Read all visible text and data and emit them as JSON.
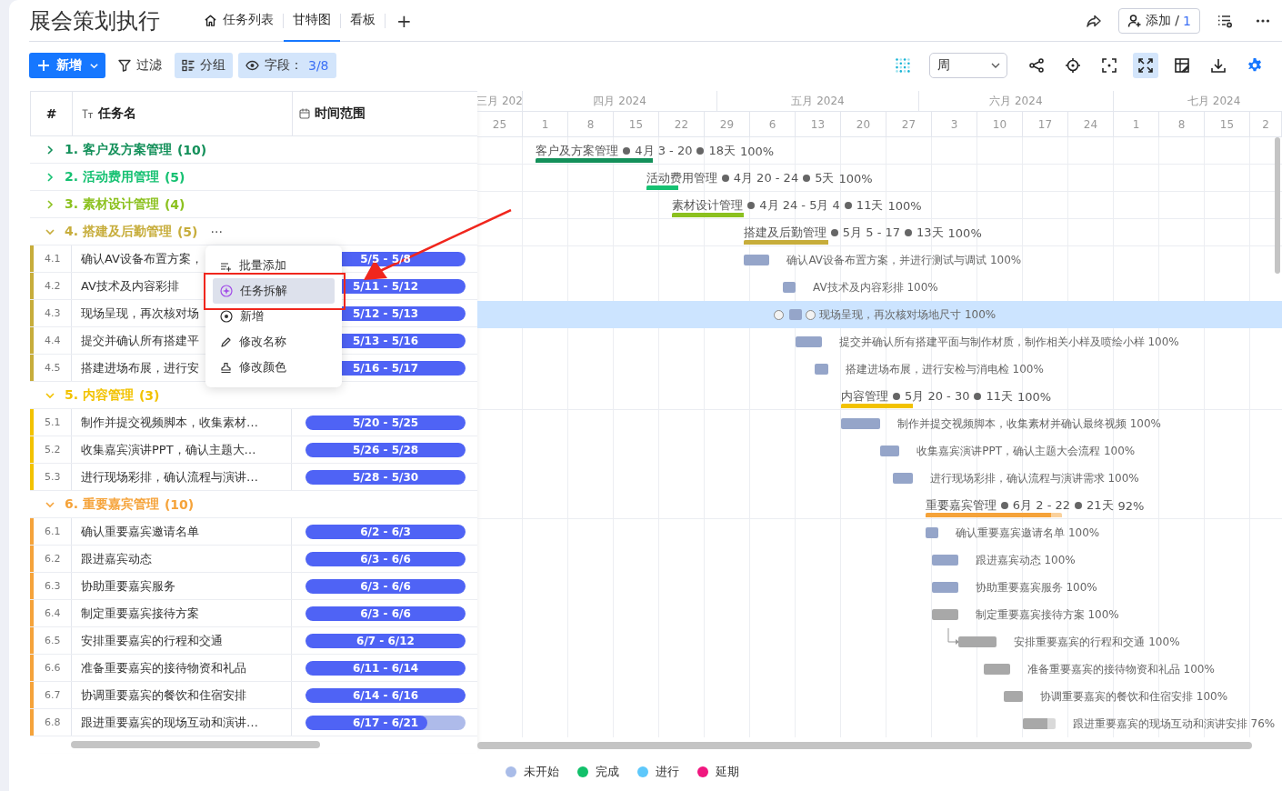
{
  "title": "展会策划执行",
  "tabs": [
    {
      "label": "任务列表",
      "kind": "home",
      "selected": false
    },
    {
      "label": "甘特图",
      "kind": "plain",
      "selected": true
    },
    {
      "label": "看板",
      "kind": "plain",
      "selected": false
    }
  ],
  "add_tab": "+",
  "add_member": {
    "label": "添加 /",
    "count": "1"
  },
  "toolbar": {
    "new": "新增",
    "filter": {
      "label": "过滤",
      "active": false
    },
    "group": {
      "label": "分组",
      "active": true
    },
    "fields": {
      "label": "字段：",
      "count": "3/8",
      "active": true
    },
    "scale": "周",
    "tools": [
      {
        "kind": "nodes",
        "active": false
      },
      {
        "kind": "locate",
        "active": false
      },
      {
        "kind": "focus",
        "active": false
      },
      {
        "kind": "expand",
        "active": true
      },
      {
        "kind": "freeze",
        "active": false
      },
      {
        "kind": "download",
        "active": false
      },
      {
        "kind": "settings",
        "active": false
      }
    ]
  },
  "columns": [
    "#",
    "任务名",
    "时间范围"
  ],
  "months": [
    "三月 202",
    "四月 2024",
    "五月 2024",
    "六月 2024",
    "七月 2024"
  ],
  "weeks": [
    "25",
    "1",
    "8",
    "15",
    "22",
    "29",
    "6",
    "13",
    "20",
    "27",
    "3",
    "10",
    "17",
    "24",
    "1",
    "8",
    "15",
    "2"
  ],
  "groups": [
    {
      "title": "1. 客户及方案管理",
      "count": "(10)",
      "color": "#14905a",
      "expanded": false,
      "gantt": {
        "name": "客户及方案管理",
        "range": "4月 3 - 20",
        "duration": "18天",
        "progress": "100%",
        "level": 1
      }
    },
    {
      "title": "2. 活动费用管理",
      "count": "(5)",
      "color": "#16c172",
      "expanded": false,
      "gantt": {
        "name": "活动费用管理",
        "range": "4月 20 - 24",
        "duration": "5天",
        "progress": "100%",
        "level": 1
      }
    },
    {
      "title": "3. 素材设计管理",
      "count": "(4)",
      "color": "#8cc11f",
      "expanded": false,
      "gantt": {
        "name": "素材设计管理",
        "range": "4月 24 - 5月 4",
        "duration": "11天",
        "progress": "100%",
        "level": 1
      }
    },
    {
      "title": "4. 搭建及后勤管理",
      "count": "(5)",
      "color": "#c7ad3b",
      "expanded": true,
      "more": "···",
      "gantt": {
        "name": "搭建及后勤管理",
        "range": "5月 5 - 17",
        "duration": "13天",
        "progress": "100%",
        "level": 1
      },
      "tasks": [
        {
          "index": "4.1",
          "name": "确认AV设备布置方案，",
          "range": "5/5 - 5/8",
          "level": 1,
          "color": "#95a5c9",
          "selected": false,
          "linked": false,
          "gantt_label": "确认AV设备布置方案，并进行测试与调试 100%"
        },
        {
          "index": "4.2",
          "name": "AV技术及内容彩排",
          "range": "5/11 - 5/12",
          "level": 1,
          "color": "#95a5c9",
          "selected": false,
          "linked": false,
          "gantt_label": "AV技术及内容彩排 100%"
        },
        {
          "index": "4.3",
          "name": "现场呈现，再次核对场",
          "range": "5/12 - 5/13",
          "level": 1,
          "color": "#95a5c9",
          "selected": true,
          "linked": false,
          "gantt_label": "现场呈现，再次核对场地尺寸 100%"
        },
        {
          "index": "4.4",
          "name": "提交并确认所有搭建平",
          "range": "5/13 - 5/16",
          "level": 1,
          "color": "#95a5c9",
          "selected": false,
          "linked": false,
          "gantt_label": "提交并确认所有搭建平面与制作材质，制作相关小样及喷绘小样 100%"
        },
        {
          "index": "4.5",
          "name": "搭建进场布展，进行安",
          "range": "5/16 - 5/17",
          "level": 1,
          "color": "#95a5c9",
          "selected": false,
          "linked": false,
          "gantt_label": "搭建进场布展，进行安检与消电检 100%"
        }
      ]
    },
    {
      "title": "5. 内容管理",
      "count": "(3)",
      "color": "#f2c200",
      "expanded": true,
      "gantt": {
        "name": "内容管理",
        "range": "5月 20 - 30",
        "duration": "11天",
        "progress": "100%",
        "level": 1
      },
      "tasks": [
        {
          "index": "5.1",
          "name": "制作并提交视频脚本，收集素材…",
          "range": "5/20 - 5/25",
          "level": 1,
          "color": "#95a5c9",
          "selected": false,
          "linked": false,
          "gantt_label": "制作并提交视频脚本，收集素材并确认最终视频 100%"
        },
        {
          "index": "5.2",
          "name": "收集嘉宾演讲PPT，确认主题大…",
          "range": "5/26 - 5/28",
          "level": 1,
          "color": "#95a5c9",
          "selected": false,
          "linked": false,
          "gantt_label": "收集嘉宾演讲PPT，确认主题大会流程 100%"
        },
        {
          "index": "5.3",
          "name": "进行现场彩排，确认流程与演讲…",
          "range": "5/28 - 5/30",
          "level": 1,
          "color": "#95a5c9",
          "selected": false,
          "linked": false,
          "gantt_label": "进行现场彩排，确认流程与演讲需求 100%"
        }
      ]
    },
    {
      "title": "6. 重要嘉宾管理",
      "count": "(10)",
      "color": "#f5a33a",
      "expanded": true,
      "gantt": {
        "name": "重要嘉宾管理",
        "range": "6月 2 - 22",
        "duration": "21天",
        "progress": "92%",
        "level": 0.92
      },
      "tasks": [
        {
          "index": "6.1",
          "name": "确认重要嘉宾邀请名单",
          "range": "6/2 - 6/3",
          "level": 1,
          "color": "#95a5c9",
          "selected": false,
          "linked": false,
          "gantt_label": "确认重要嘉宾邀请名单 100%"
        },
        {
          "index": "6.2",
          "name": "跟进嘉宾动态",
          "range": "6/3 - 6/6",
          "level": 1,
          "color": "#95a5c9",
          "selected": false,
          "linked": false,
          "gantt_label": "跟进嘉宾动态 100%"
        },
        {
          "index": "6.3",
          "name": "协助重要嘉宾服务",
          "range": "6/3 - 6/6",
          "level": 1,
          "color": "#95a5c9",
          "selected": false,
          "linked": false,
          "gantt_label": "协助重要嘉宾服务 100%"
        },
        {
          "index": "6.4",
          "name": "制定重要嘉宾接待方案",
          "range": "6/3 - 6/6",
          "level": 1,
          "color": "#a8a8a8",
          "selected": false,
          "linked": false,
          "gantt_label": "制定重要嘉宾接待方案 100%"
        },
        {
          "index": "6.5",
          "name": "安排重要嘉宾的行程和交通",
          "range": "6/7 - 6/12",
          "level": 1,
          "color": "#a8a8a8",
          "selected": false,
          "linked": true,
          "gantt_label": "安排重要嘉宾的行程和交通 100%"
        },
        {
          "index": "6.6",
          "name": "准备重要嘉宾的接待物资和礼品",
          "range": "6/11 - 6/14",
          "level": 1,
          "color": "#a8a8a8",
          "selected": false,
          "linked": false,
          "gantt_label": "准备重要嘉宾的接待物资和礼品 100%"
        },
        {
          "index": "6.7",
          "name": "协调重要嘉宾的餐饮和住宿安排",
          "range": "6/14 - 6/16",
          "level": 1,
          "color": "#a8a8a8",
          "selected": false,
          "linked": false,
          "gantt_label": "协调重要嘉宾的餐饮和住宿安排 100%"
        },
        {
          "index": "6.8",
          "name": "跟进重要嘉宾的现场互动和演讲…",
          "range": "6/17 - 6/21",
          "level": 0.76,
          "color": "#a8a8a8",
          "selected": false,
          "linked": false,
          "gantt_label": "跟进重要嘉宾的现场互动和演讲安排 76%"
        }
      ]
    }
  ],
  "menu": {
    "items": [
      {
        "label": "批量添加",
        "kind": "batch",
        "selected": false
      },
      {
        "label": "任务拆解",
        "kind": "sparkle",
        "selected": true
      },
      {
        "label": "新增",
        "kind": "add",
        "selected": false
      },
      {
        "label": "修改名称",
        "kind": "rename",
        "selected": false
      },
      {
        "label": "修改颜色",
        "kind": "color",
        "selected": false
      }
    ]
  },
  "legend": [
    {
      "label": "未开始",
      "color": "#a9bce8"
    },
    {
      "label": "完成",
      "color": "#12c06a"
    },
    {
      "label": "进行",
      "color": "#5ec8fb"
    },
    {
      "label": "延期",
      "color": "#f0177f"
    }
  ]
}
